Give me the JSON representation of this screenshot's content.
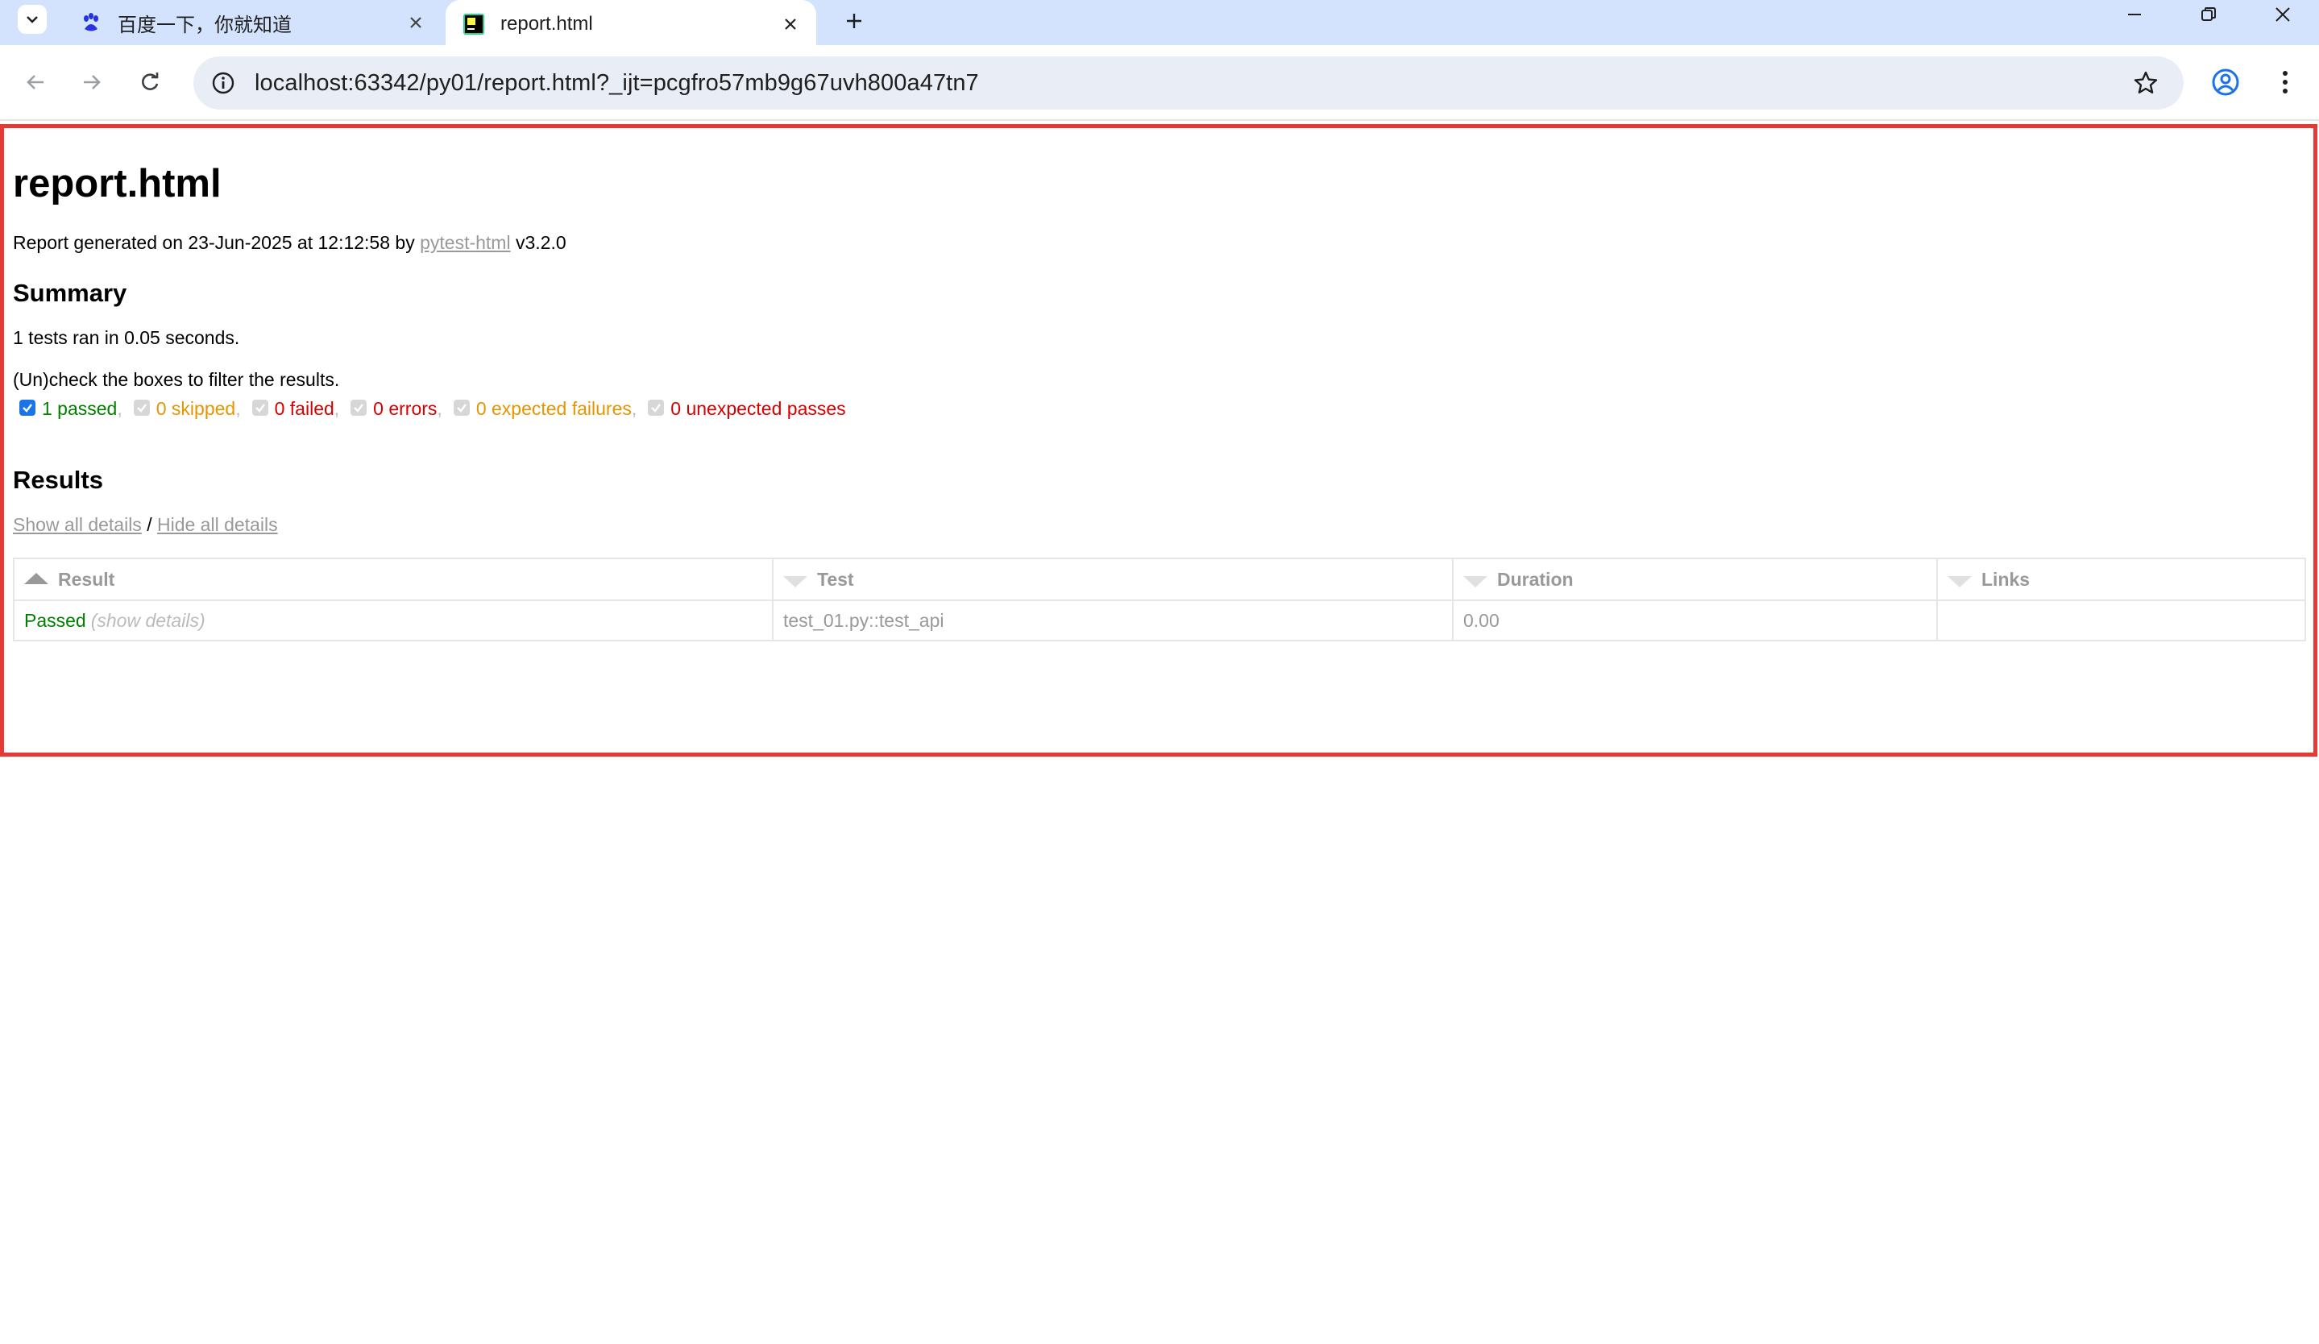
{
  "browser": {
    "tabs": [
      {
        "title": "百度一下，你就知道",
        "favicon": "baidu-paw-icon",
        "active": false
      },
      {
        "title": "report.html",
        "favicon": "pycharm-icon",
        "active": true
      }
    ],
    "url": "localhost:63342/py01/report.html?_ijt=pcgfro57mb9g67uvh800a47tn7"
  },
  "report": {
    "title": "report.html",
    "generated_prefix": "Report generated on 23-Jun-2025 at 12:12:58 by ",
    "generated_link": "pytest-html",
    "generated_suffix": " v3.2.0",
    "summary_heading": "Summary",
    "tests_ran": "1 tests ran in 0.05 seconds.",
    "filter_hint": "(Un)check the boxes to filter the results.",
    "filters": [
      {
        "label": "1 passed",
        "checked": true,
        "status": "passed"
      },
      {
        "label": "0 skipped",
        "checked": true,
        "status": "skipped"
      },
      {
        "label": "0 failed",
        "checked": true,
        "status": "failed"
      },
      {
        "label": "0 errors",
        "checked": true,
        "status": "error"
      },
      {
        "label": "0 expected failures",
        "checked": true,
        "status": "xfail"
      },
      {
        "label": "0 unexpected passes",
        "checked": true,
        "status": "xpass"
      }
    ],
    "results_heading": "Results",
    "show_all": "Show all details",
    "separator": " / ",
    "hide_all": "Hide all details",
    "columns": [
      "Result",
      "Test",
      "Duration",
      "Links"
    ],
    "rows": [
      {
        "result": "Passed",
        "details": "(show details)",
        "test": "test_01.py::test_api",
        "duration": "0.00",
        "links": ""
      }
    ]
  },
  "colors": {
    "passed": "#008000",
    "skipped": "#e69500",
    "failed": "#d60000",
    "highlight_border": "#e53935"
  }
}
